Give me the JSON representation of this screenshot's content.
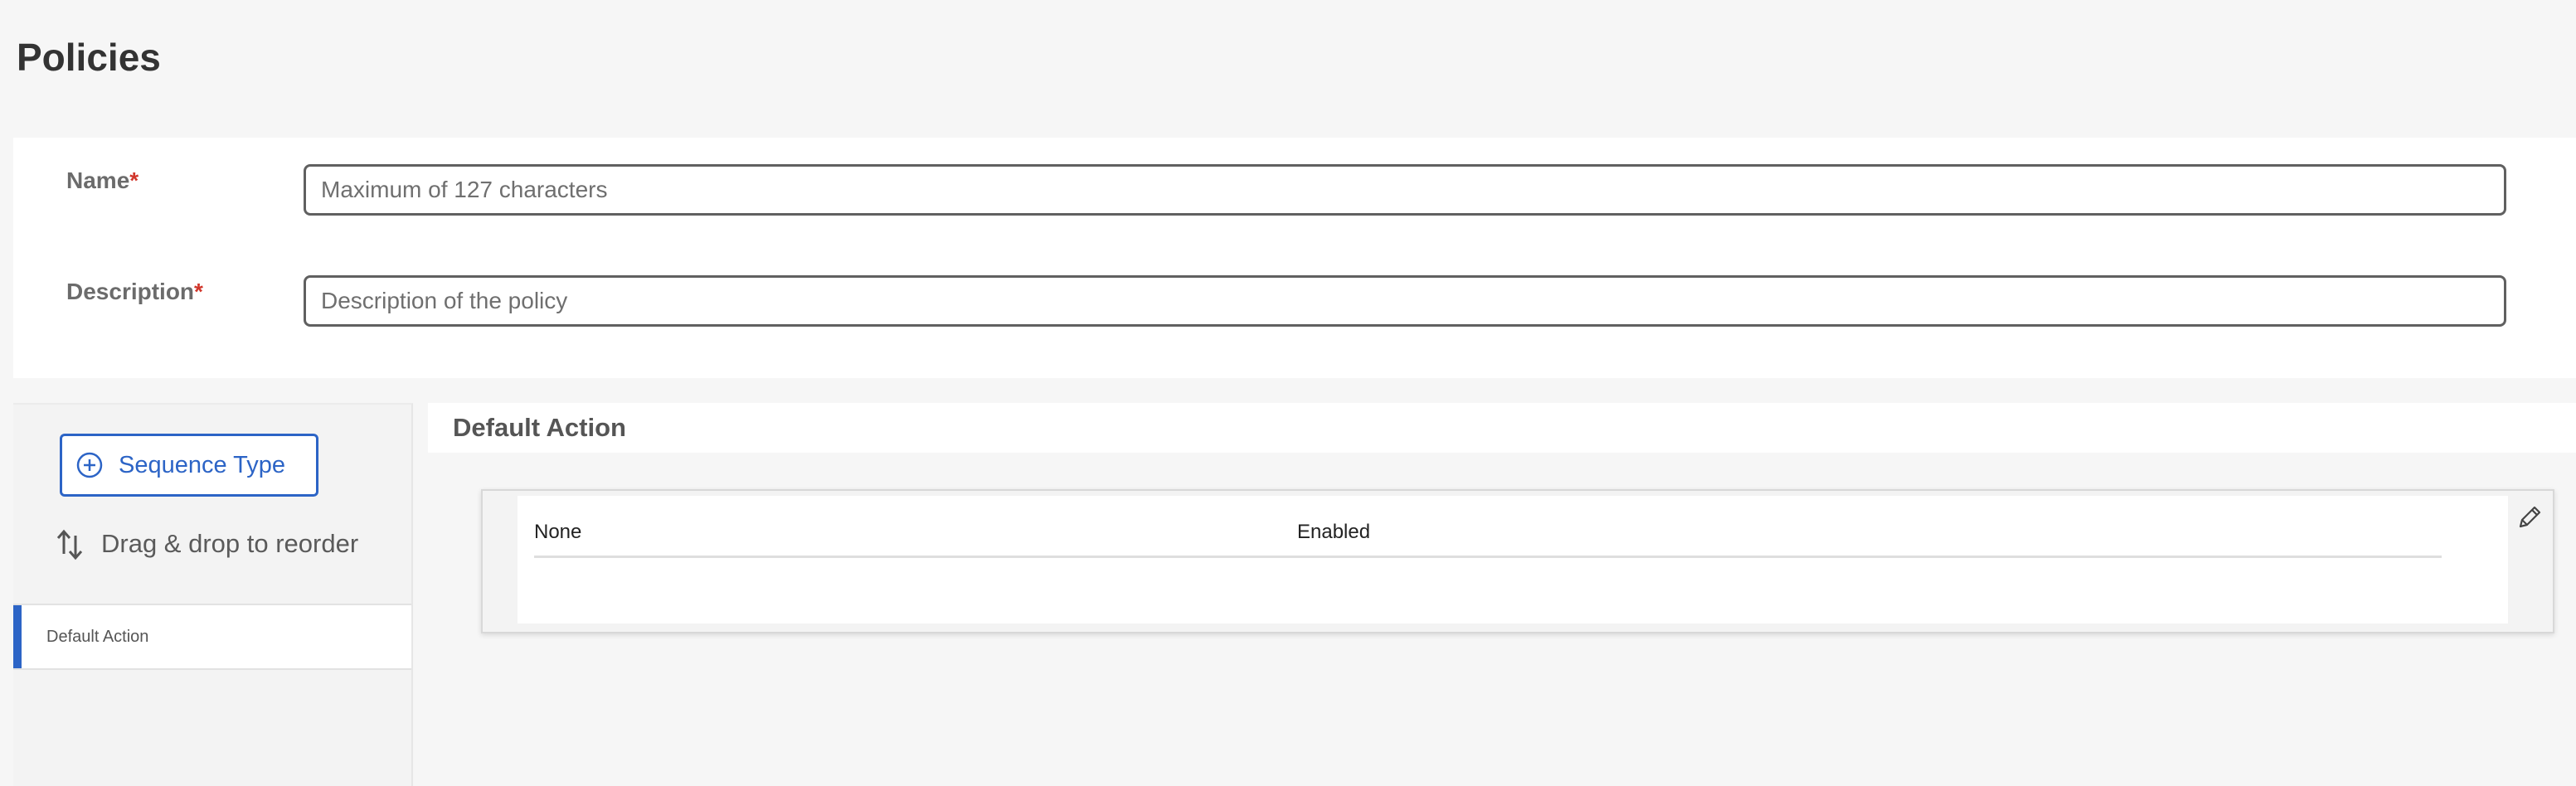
{
  "page": {
    "title": "Policies"
  },
  "form": {
    "name_label": "Name",
    "name_required": "*",
    "name_placeholder": "Maximum of 127 characters",
    "name_value": "",
    "description_label": "Description",
    "description_required": "*",
    "description_placeholder": "Description of the policy",
    "description_value": ""
  },
  "sidebar": {
    "add_button_label": "Sequence Type",
    "add_button_icon": "plus-circle-icon",
    "drag_hint": "Drag & drop to reorder",
    "drag_icon": "sort-arrows-icon",
    "items": [
      {
        "label": "Default Action",
        "active": true
      }
    ]
  },
  "main": {
    "section_title": "Default Action",
    "rows": [
      {
        "action": "None",
        "status": "Enabled"
      }
    ],
    "edit_icon": "pencil-icon"
  },
  "colors": {
    "accent": "#2c64c6",
    "required": "#d1362b",
    "background": "#f6f6f6"
  }
}
